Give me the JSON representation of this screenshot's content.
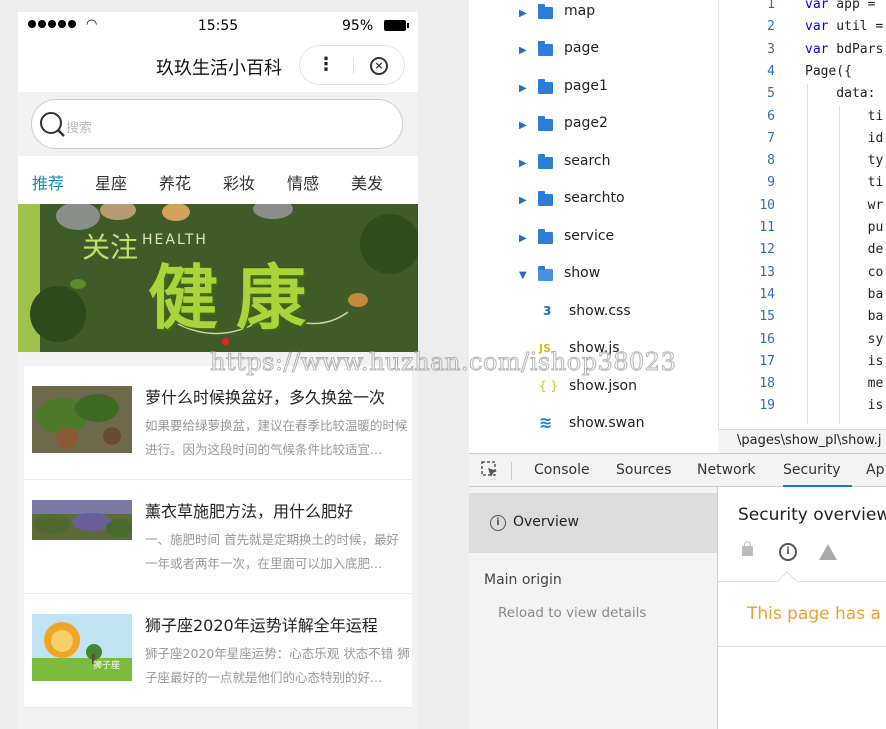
{
  "phone": {
    "status": {
      "time": "15:55",
      "battery": "95%"
    },
    "nav": {
      "title": "玖玖生活小百科"
    },
    "search": {
      "placeholder": "搜索"
    },
    "tabs": [
      "推荐",
      "星座",
      "养花",
      "彩妆",
      "情感",
      "美发"
    ],
    "banner": {
      "line1": "关注",
      "line2": "HEALTH",
      "line3": "健康"
    },
    "articles": [
      {
        "title": "萝什么时候换盆好，多久换盆一次",
        "desc": "如果要给绿萝换盆，建议在春季比较温暖的时候进行。因为这段时间的气候条件比较适宜..."
      },
      {
        "title": "薰衣草施肥方法，用什么肥好",
        "desc": "一、施肥时间 首先就是定期换土的时候，最好一年或者两年一次，在里面可以加入底肥..."
      },
      {
        "title": "狮子座2020年运势详解全年运程",
        "desc": "狮子座2020年星座运势：心态乐观 状态不错 狮子座最好的一点就是他们的心态特别的好..."
      }
    ],
    "thumb3_label": "狮子座"
  },
  "filetree": {
    "folders": [
      "map",
      "page",
      "page1",
      "page2",
      "search",
      "searchto",
      "service"
    ],
    "open_folder": "show",
    "files": [
      {
        "name": "show.css",
        "icon": "css-file-icon",
        "glyph": "3",
        "color": "#1f6fc5"
      },
      {
        "name": "show.js",
        "icon": "js-file-icon",
        "glyph": "JS",
        "color": "#e6b91e"
      },
      {
        "name": "show.json",
        "icon": "json-file-icon",
        "glyph": "{ }",
        "color": "#e6b91e"
      },
      {
        "name": "show.swan",
        "icon": "swan-file-icon",
        "glyph": "≋",
        "color": "#1f7fd5"
      }
    ]
  },
  "editor": {
    "lines": [
      {
        "n": "1",
        "kw": "var",
        "rest": " app ="
      },
      {
        "n": "2",
        "kw": "var",
        "rest": " util ="
      },
      {
        "n": "3",
        "kw": "var",
        "rest": " bdPars"
      },
      {
        "n": "4",
        "kw": "",
        "rest": "Page({"
      },
      {
        "n": "5",
        "kw": "",
        "rest": "    data:"
      },
      {
        "n": "6",
        "kw": "",
        "rest": "        ti"
      },
      {
        "n": "7",
        "kw": "",
        "rest": "        id"
      },
      {
        "n": "8",
        "kw": "",
        "rest": "        ty"
      },
      {
        "n": "9",
        "kw": "",
        "rest": "        ti"
      },
      {
        "n": "10",
        "kw": "",
        "rest": "        wr"
      },
      {
        "n": "11",
        "kw": "",
        "rest": "        pu"
      },
      {
        "n": "12",
        "kw": "",
        "rest": "        de"
      },
      {
        "n": "13",
        "kw": "",
        "rest": "        co"
      },
      {
        "n": "14",
        "kw": "",
        "rest": "        ba"
      },
      {
        "n": "15",
        "kw": "",
        "rest": "        ba"
      },
      {
        "n": "16",
        "kw": "",
        "rest": "        sy"
      },
      {
        "n": "17",
        "kw": "",
        "rest": "        is"
      },
      {
        "n": "18",
        "kw": "",
        "rest": "        me"
      },
      {
        "n": "19",
        "kw": "",
        "rest": "        is"
      }
    ],
    "path": "\\pages\\show_pl\\show.j"
  },
  "devtools": {
    "tabs": [
      "Console",
      "Sources",
      "Network",
      "Security",
      "Ap"
    ],
    "active_tab": "Security",
    "sidebar": {
      "overview": "Overview",
      "main_origin": "Main origin",
      "reload": "Reload to view details"
    },
    "panel": {
      "title": "Security overview",
      "message": "This page has a n"
    }
  },
  "watermark": "https://www.huzhan.com/ishop38023"
}
